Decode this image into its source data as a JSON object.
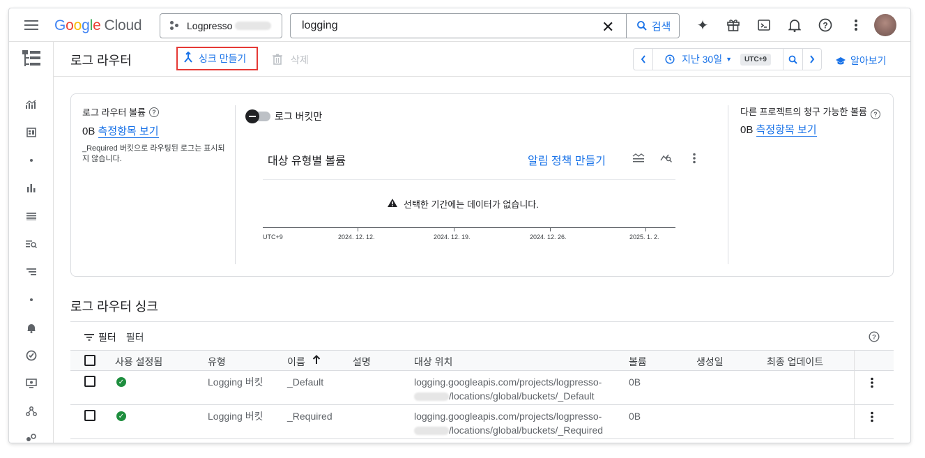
{
  "topbar": {
    "logo": {
      "g": "G",
      "o1": "o",
      "o2": "o",
      "g2": "g",
      "l": "l",
      "e": "e",
      "cloud": "Cloud"
    },
    "project_name": "Logpresso",
    "search_value": "logging",
    "search_button": "검색",
    "icons": [
      "gemini-icon",
      "gift-icon",
      "cloud-shell-icon",
      "notifications-icon",
      "help-icon",
      "more-vert-icon"
    ]
  },
  "page": {
    "title": "로그 라우터",
    "create_sink": "싱크 만들기",
    "delete": "삭제",
    "time_range": "지난 30일",
    "timezone": "UTC+9",
    "learn": "알아보기"
  },
  "volume_card": {
    "router_volume_label": "로그 라우터 볼륨",
    "router_volume_value": "0B",
    "view_metrics": "측정항목 보기",
    "required_note": "_Required 버킷으로 라우팅된 로그는 표시되지 않습니다.",
    "bucket_only_toggle": "로그 버킷만",
    "chart_title": "대상 유형별 볼륨",
    "create_alert": "알림 정책 만들기",
    "no_data": "선택한 기간에는 데이터가 없습니다.",
    "axis_tz": "UTC+9",
    "axis_ticks": [
      "2024. 12. 12.",
      "2024. 12. 19.",
      "2024. 12. 26.",
      "2025. 1. 2."
    ],
    "other_projects_label": "다른 프로젝트의 청구 가능한 볼륨",
    "other_projects_value": "0B",
    "other_view_metrics": "측정항목 보기"
  },
  "sinks": {
    "title": "로그 라우터 싱크",
    "filter_label": "필터",
    "filter_placeholder": "필터",
    "columns": [
      "사용 설정됨",
      "유형",
      "이름",
      "설명",
      "대상 위치",
      "볼륨",
      "생성일",
      "최종 업데이트"
    ],
    "rows": [
      {
        "type": "Logging 버킷",
        "name": "_Default",
        "dest_line1": "logging.googleapis.com/projects/logpresso-",
        "dest_line2": "/locations/global/buckets/_Default",
        "volume": "0B"
      },
      {
        "type": "Logging 버킷",
        "name": "_Required",
        "dest_line1": "logging.googleapis.com/projects/logpresso-",
        "dest_line2": "/locations/global/buckets/_Required",
        "volume": "0B"
      }
    ]
  },
  "colors": {
    "accent": "#1a73e8",
    "highlight_border": "#e53935",
    "ok": "#1e8e3e"
  }
}
